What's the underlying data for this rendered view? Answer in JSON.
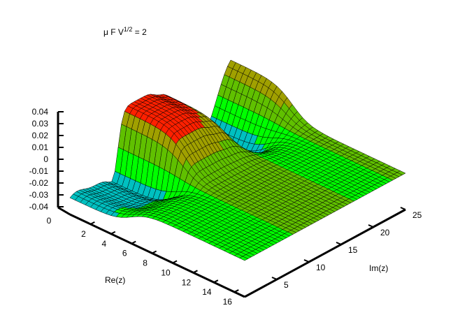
{
  "chart_data": {
    "type": "surface",
    "title_prefix": "μ F V",
    "title_sup": "1/2",
    "title_suffix": " = 2",
    "xlabel": "Re(z)",
    "ylabel": "Im(z)",
    "xlim": [
      0,
      17
    ],
    "ylim": [
      0,
      25
    ],
    "zlim": [
      -0.04,
      0.04
    ],
    "x_ticks": [
      "2",
      "4",
      "6",
      "8",
      "10",
      "12",
      "14",
      "16"
    ],
    "x_tick_values": [
      2,
      4,
      6,
      8,
      10,
      12,
      14,
      16
    ],
    "y_ticks": [
      "5",
      "10",
      "15",
      "20",
      "25"
    ],
    "y_tick_values": [
      5,
      10,
      15,
      20,
      25
    ],
    "z_ticks": [
      "0.04",
      "0.03",
      "0.02",
      "0.01",
      "0",
      "-0.01",
      "-0.02",
      "-0.03",
      "-0.04"
    ],
    "z_tick_values": [
      0.04,
      0.03,
      0.02,
      0.01,
      0,
      -0.01,
      -0.02,
      -0.03,
      -0.04
    ],
    "base_label": "0",
    "surface": {
      "description_values": {
        "plateau_far_field": 0.0,
        "near_edge_max": 0.035,
        "near_edge_min": -0.045,
        "transition_re": 6,
        "peak_re_range": [
          0,
          7
        ],
        "peak_im_range": [
          7,
          14
        ]
      }
    },
    "colormap": [
      "#2020ff",
      "#00c0c0",
      "#00ff00",
      "#60c000",
      "#a0a000",
      "#ff2000"
    ],
    "grid": false
  }
}
